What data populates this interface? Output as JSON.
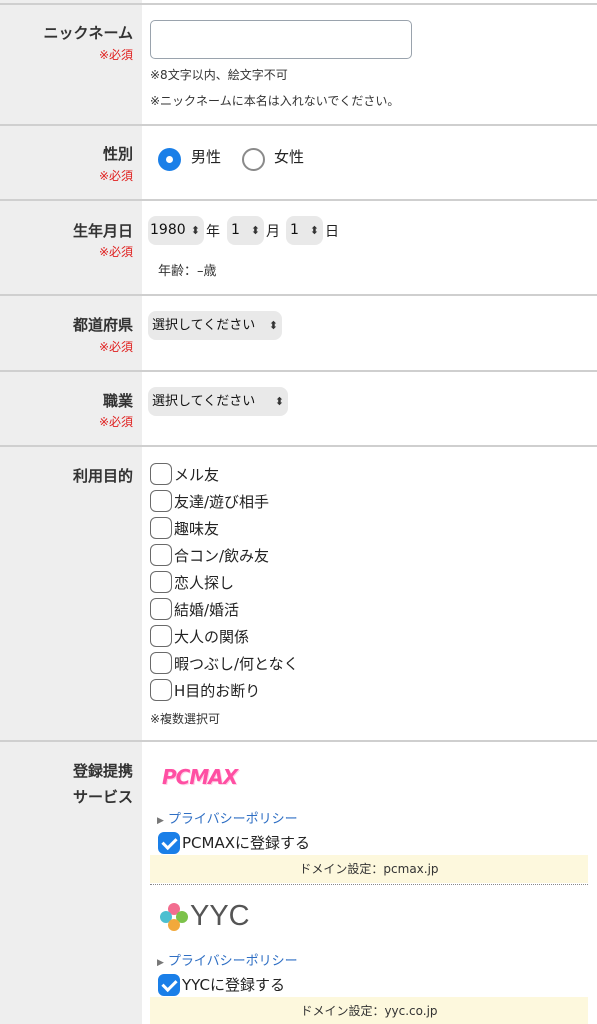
{
  "nickname": {
    "label": "ニックネーム",
    "required": "※必須",
    "value": "",
    "note1": "※8文字以内、絵文字不可",
    "note2": "※ニックネームに本名は入れないでください。"
  },
  "gender": {
    "label": "性別",
    "required": "※必須",
    "options": [
      "男性",
      "女性"
    ],
    "selected": "男性"
  },
  "birthday": {
    "label": "生年月日",
    "required": "※必須",
    "year": "1980",
    "year_unit": "年",
    "month": "1",
    "month_unit": "月",
    "day": "1",
    "day_unit": "日",
    "age_text": "年齢：–歳"
  },
  "prefecture": {
    "label": "都道府県",
    "required": "※必須",
    "value": "選択してください"
  },
  "occupation": {
    "label": "職業",
    "required": "※必須",
    "value": "選択してください"
  },
  "purpose": {
    "label": "利用目的",
    "options": [
      "メル友",
      "友達/遊び相手",
      "趣味友",
      "合コン/飲み友",
      "恋人探し",
      "結婚/婚活",
      "大人の関係",
      "暇つぶし/何となく",
      "H目的お断り"
    ],
    "note": "※複数選択可"
  },
  "services": {
    "label_line1": "登録提携",
    "label_line2": "サービス",
    "items": [
      {
        "logo": "PCMAX",
        "policy": "プライバシーポリシー",
        "register": "PCMAXに登録する",
        "checked": true,
        "domain": "ドメイン設定：pcmax.jp"
      },
      {
        "logo": "YYC",
        "policy": "プライバシーポリシー",
        "register": "YYCに登録する",
        "checked": true,
        "domain": "ドメイン設定：yyc.co.jp"
      }
    ]
  },
  "colors": {
    "accent": "#1a7fe8",
    "required": "#e0201f",
    "link": "#2f6fc4",
    "label_bg": "#eeeeee",
    "domain_bg": "#fdf8dd"
  }
}
